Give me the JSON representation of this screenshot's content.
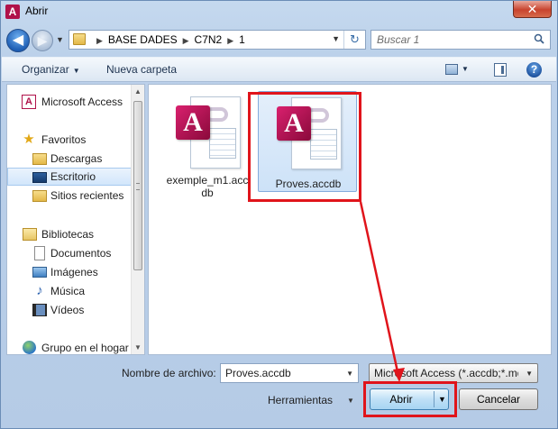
{
  "window": {
    "title": "Abrir",
    "close_glyph": "✕",
    "app_icon_letter": "A"
  },
  "address": {
    "crumbs": [
      "BASE DADES",
      "C7N2",
      "1"
    ],
    "separator": "▶"
  },
  "search": {
    "placeholder": "Buscar 1"
  },
  "toolbar": {
    "organize_label": "Organizar",
    "new_folder_label": "Nueva carpeta"
  },
  "sidebar": {
    "items": [
      {
        "label": "Microsoft Access",
        "icon": "access-icon"
      },
      {
        "label": "Favoritos",
        "icon": "star-icon"
      },
      {
        "label": "Descargas",
        "icon": "downloads-folder-icon"
      },
      {
        "label": "Escritorio",
        "icon": "desktop-icon",
        "selected": true
      },
      {
        "label": "Sitios recientes",
        "icon": "recent-places-icon"
      },
      {
        "label": "Bibliotecas",
        "icon": "libraries-icon"
      },
      {
        "label": "Documentos",
        "icon": "documents-icon"
      },
      {
        "label": "Imágenes",
        "icon": "pictures-icon"
      },
      {
        "label": "Música",
        "icon": "music-icon"
      },
      {
        "label": "Vídeos",
        "icon": "videos-icon"
      },
      {
        "label": "Grupo en el hogar",
        "icon": "homegroup-icon"
      }
    ]
  },
  "files": [
    {
      "name_line1": "exemple_m1.acc",
      "name_line2": "db",
      "selected": false
    },
    {
      "name_line1": "Proves.accdb",
      "name_line2": "",
      "selected": true
    }
  ],
  "footer": {
    "filename_label": "Nombre de archivo:",
    "filename_value": "Proves.accdb",
    "filetype_value": "Microsoft Access (*.accdb;*.mdb)",
    "tools_label": "Herramientas",
    "open_label": "Abrir",
    "cancel_label": "Cancelar"
  },
  "colors": {
    "annotation": "#e0141b",
    "access_brand": "#b0124a"
  }
}
